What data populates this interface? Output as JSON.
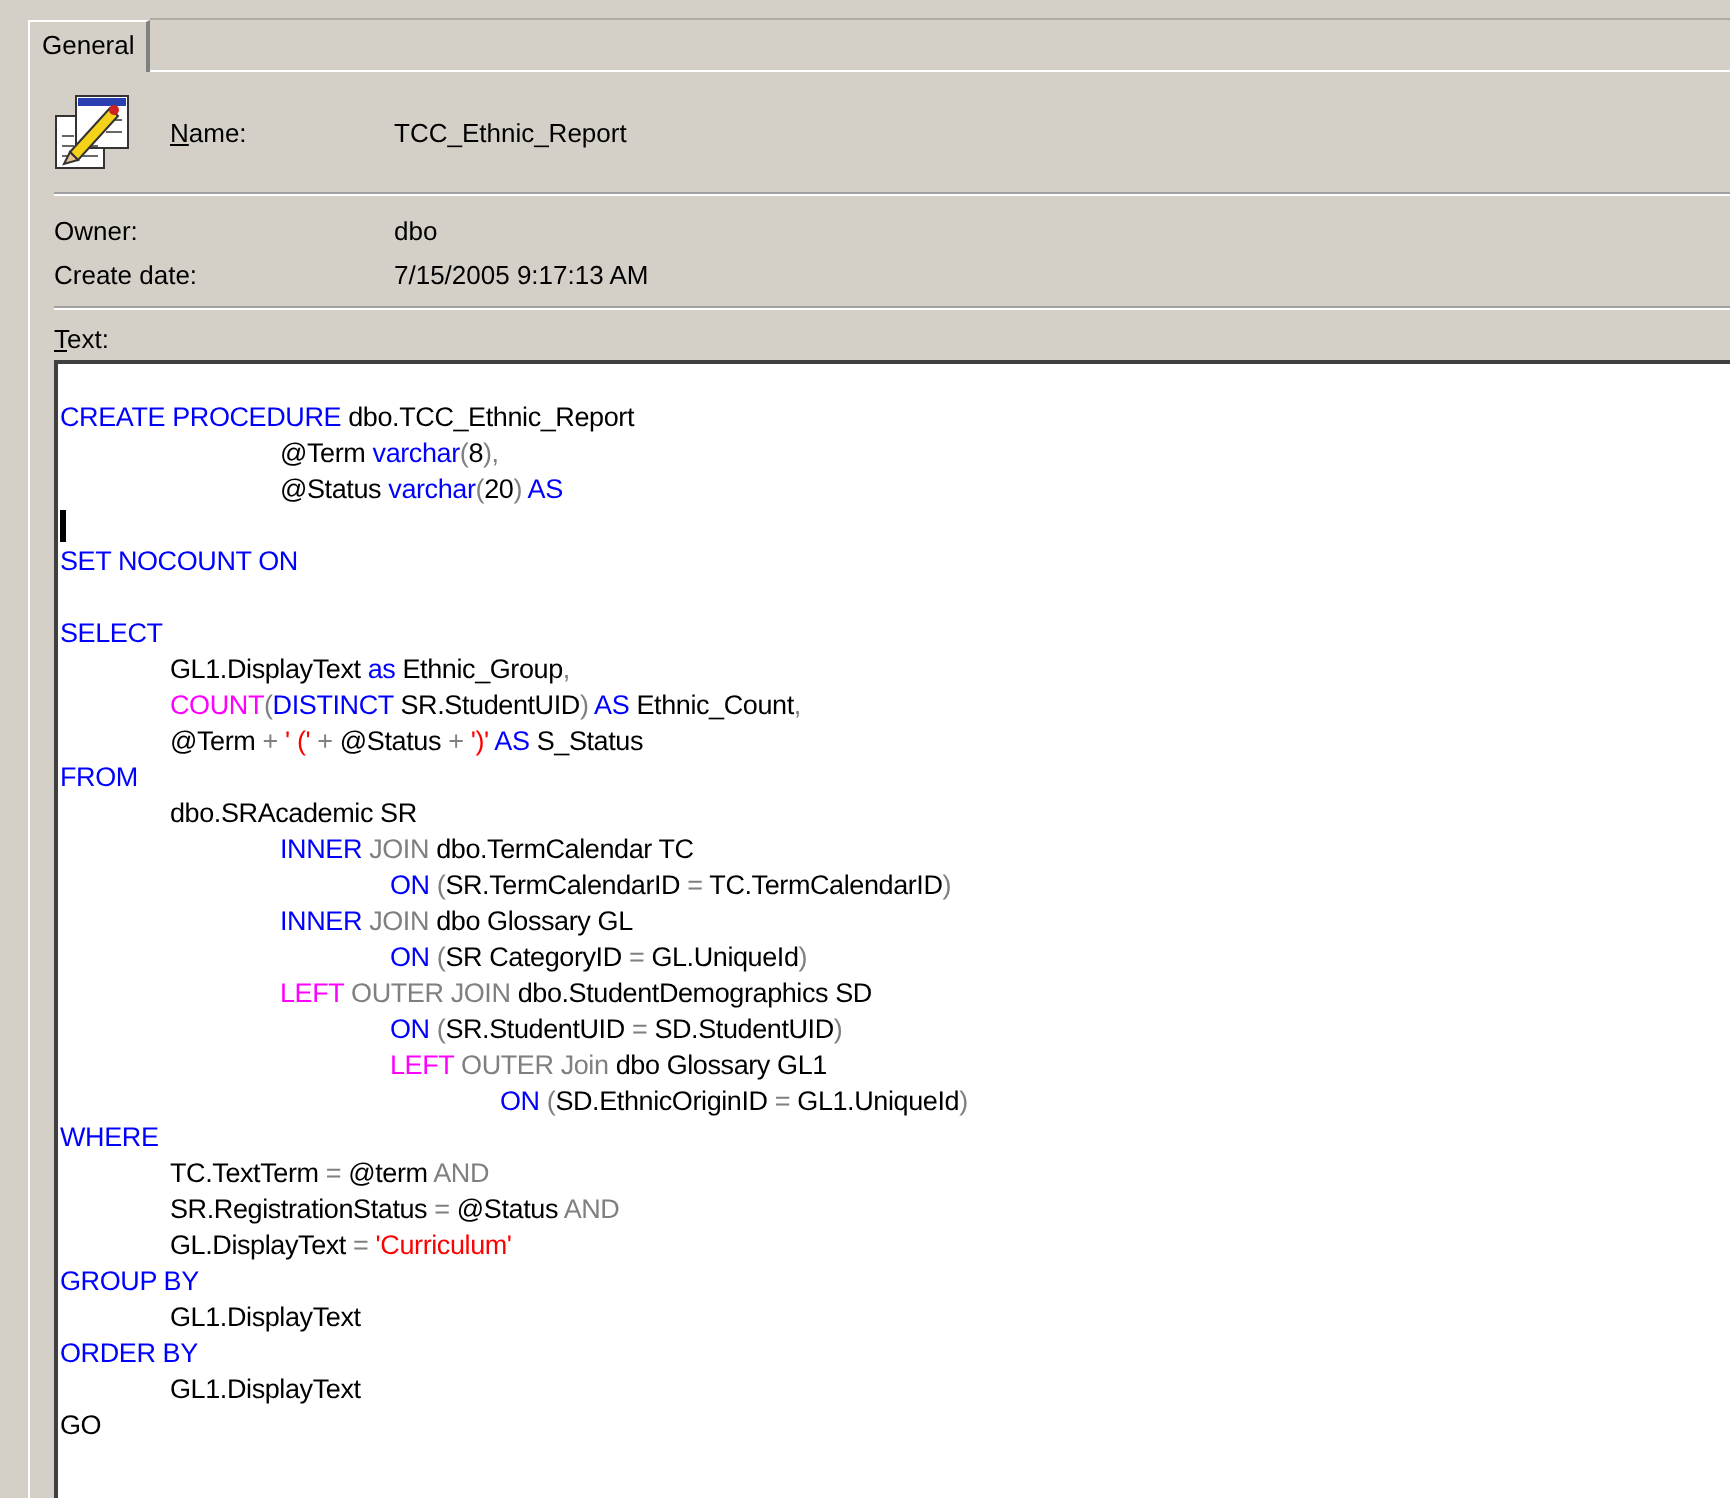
{
  "tabs": [
    {
      "label": "General",
      "selected": true
    }
  ],
  "name": {
    "label": "Name:",
    "value": "TCC_Ethnic_Report"
  },
  "properties": [
    {
      "label": "Owner:",
      "value": "dbo"
    },
    {
      "label": "Create date:",
      "value": "7/15/2005 9:17:13 AM"
    }
  ],
  "text_label": "Text:",
  "code_lines": [
    {
      "kind": "code",
      "segments": [
        {
          "kind": "keyword",
          "text": "CREATE PROCEDURE "
        },
        {
          "kind": "plain",
          "text": "dbo.TCC_Ethnic_Report"
        }
      ]
    },
    {
      "kind": "code",
      "segments": [
        {
          "kind": "plain",
          "text": "\t\t@Term "
        },
        {
          "kind": "keyword",
          "text": "varchar"
        },
        {
          "kind": "operator",
          "text": "("
        },
        {
          "kind": "plain",
          "text": "8"
        },
        {
          "kind": "operator",
          "text": "),"
        }
      ]
    },
    {
      "kind": "code",
      "segments": [
        {
          "kind": "plain",
          "text": "\t\t@Status "
        },
        {
          "kind": "keyword",
          "text": "varchar"
        },
        {
          "kind": "operator",
          "text": "("
        },
        {
          "kind": "plain",
          "text": "20"
        },
        {
          "kind": "operator",
          "text": ") "
        },
        {
          "kind": "keyword",
          "text": "AS"
        }
      ]
    },
    {
      "kind": "cursor"
    },
    {
      "kind": "code",
      "segments": [
        {
          "kind": "keyword",
          "text": "SET NOCOUNT ON"
        }
      ]
    },
    {
      "kind": "blank"
    },
    {
      "kind": "code",
      "segments": [
        {
          "kind": "keyword",
          "text": "SELECT"
        }
      ]
    },
    {
      "kind": "code",
      "segments": [
        {
          "kind": "plain",
          "text": "\tGL1.DisplayText "
        },
        {
          "kind": "keyword",
          "text": "as"
        },
        {
          "kind": "plain",
          "text": " Ethnic_Group"
        },
        {
          "kind": "operator",
          "text": ","
        }
      ]
    },
    {
      "kind": "code",
      "segments": [
        {
          "kind": "function",
          "text": "\tCOUNT"
        },
        {
          "kind": "operator",
          "text": "("
        },
        {
          "kind": "keyword",
          "text": "DISTINCT"
        },
        {
          "kind": "plain",
          "text": " SR.StudentUID"
        },
        {
          "kind": "operator",
          "text": ")"
        },
        {
          "kind": "keyword",
          "text": " AS"
        },
        {
          "kind": "plain",
          "text": " Ethnic_Count"
        },
        {
          "kind": "operator",
          "text": ","
        }
      ]
    },
    {
      "kind": "code",
      "segments": [
        {
          "kind": "plain",
          "text": "\t@Term "
        },
        {
          "kind": "operator",
          "text": "+ "
        },
        {
          "kind": "string",
          "text": "' (' "
        },
        {
          "kind": "operator",
          "text": "+ "
        },
        {
          "kind": "plain",
          "text": "@Status "
        },
        {
          "kind": "operator",
          "text": "+ "
        },
        {
          "kind": "string",
          "text": "')' "
        },
        {
          "kind": "keyword",
          "text": "AS"
        },
        {
          "kind": "plain",
          "text": " S_Status"
        }
      ]
    },
    {
      "kind": "code",
      "segments": [
        {
          "kind": "keyword",
          "text": "FROM"
        }
      ]
    },
    {
      "kind": "code",
      "segments": [
        {
          "kind": "plain",
          "text": "\tdbo.SRAcademic SR"
        }
      ]
    },
    {
      "kind": "code",
      "segments": [
        {
          "kind": "keyword",
          "text": "\t\tINNER "
        },
        {
          "kind": "operator",
          "text": "JOIN "
        },
        {
          "kind": "plain",
          "text": "dbo.TermCalendar TC"
        }
      ]
    },
    {
      "kind": "code",
      "segments": [
        {
          "kind": "keyword",
          "text": "\t\t\tON "
        },
        {
          "kind": "operator",
          "text": "("
        },
        {
          "kind": "plain",
          "text": "SR.TermCalendarID "
        },
        {
          "kind": "operator",
          "text": "= "
        },
        {
          "kind": "plain",
          "text": "TC.TermCalendarID"
        },
        {
          "kind": "operator",
          "text": ")"
        }
      ]
    },
    {
      "kind": "code",
      "segments": [
        {
          "kind": "keyword",
          "text": "\t\tINNER "
        },
        {
          "kind": "operator",
          "text": "JOIN "
        },
        {
          "kind": "plain",
          "text": "dbo Glossary GL"
        }
      ]
    },
    {
      "kind": "code",
      "segments": [
        {
          "kind": "keyword",
          "text": "\t\t\tON "
        },
        {
          "kind": "operator",
          "text": "("
        },
        {
          "kind": "plain",
          "text": "SR CategoryID "
        },
        {
          "kind": "operator",
          "text": "= "
        },
        {
          "kind": "plain",
          "text": "GL.UniqueId"
        },
        {
          "kind": "operator",
          "text": ")"
        }
      ]
    },
    {
      "kind": "code",
      "segments": [
        {
          "kind": "function",
          "text": "\t\tLEFT "
        },
        {
          "kind": "operator",
          "text": "OUTER JOIN "
        },
        {
          "kind": "plain",
          "text": "dbo.StudentDemographics SD"
        }
      ]
    },
    {
      "kind": "code",
      "segments": [
        {
          "kind": "keyword",
          "text": "\t\t\tON "
        },
        {
          "kind": "operator",
          "text": "("
        },
        {
          "kind": "plain",
          "text": "SR.StudentUID "
        },
        {
          "kind": "operator",
          "text": "= "
        },
        {
          "kind": "plain",
          "text": "SD.StudentUID"
        },
        {
          "kind": "operator",
          "text": ")"
        }
      ]
    },
    {
      "kind": "code",
      "segments": [
        {
          "kind": "function",
          "text": "\t\t\tLEFT "
        },
        {
          "kind": "operator",
          "text": "OUTER Join "
        },
        {
          "kind": "plain",
          "text": "dbo Glossary GL1"
        }
      ]
    },
    {
      "kind": "code",
      "segments": [
        {
          "kind": "keyword",
          "text": "\t\t\t\tON "
        },
        {
          "kind": "operator",
          "text": "("
        },
        {
          "kind": "plain",
          "text": "SD.EthnicOriginID "
        },
        {
          "kind": "operator",
          "text": "= "
        },
        {
          "kind": "plain",
          "text": "GL1.UniqueId"
        },
        {
          "kind": "operator",
          "text": ")"
        }
      ]
    },
    {
      "kind": "code",
      "segments": [
        {
          "kind": "keyword",
          "text": "WHERE"
        }
      ]
    },
    {
      "kind": "code",
      "segments": [
        {
          "kind": "plain",
          "text": "\tTC.TextTerm "
        },
        {
          "kind": "operator",
          "text": "= "
        },
        {
          "kind": "plain",
          "text": "@term "
        },
        {
          "kind": "operator",
          "text": "AND"
        }
      ]
    },
    {
      "kind": "code",
      "segments": [
        {
          "kind": "plain",
          "text": "\tSR.RegistrationStatus "
        },
        {
          "kind": "operator",
          "text": "= "
        },
        {
          "kind": "plain",
          "text": "@Status "
        },
        {
          "kind": "operator",
          "text": "AND"
        }
      ]
    },
    {
      "kind": "code",
      "segments": [
        {
          "kind": "plain",
          "text": "\tGL.DisplayText "
        },
        {
          "kind": "operator",
          "text": "= "
        },
        {
          "kind": "string",
          "text": "'Curriculum'"
        }
      ]
    },
    {
      "kind": "code",
      "segments": [
        {
          "kind": "keyword",
          "text": "GROUP BY"
        }
      ]
    },
    {
      "kind": "code",
      "segments": [
        {
          "kind": "plain",
          "text": "\tGL1.DisplayText"
        }
      ]
    },
    {
      "kind": "code",
      "segments": [
        {
          "kind": "keyword",
          "text": "ORDER BY"
        }
      ]
    },
    {
      "kind": "code",
      "segments": [
        {
          "kind": "plain",
          "text": "\tGL1.DisplayText"
        }
      ]
    },
    {
      "kind": "code",
      "segments": [
        {
          "kind": "plain",
          "text": "GO"
        }
      ]
    }
  ]
}
